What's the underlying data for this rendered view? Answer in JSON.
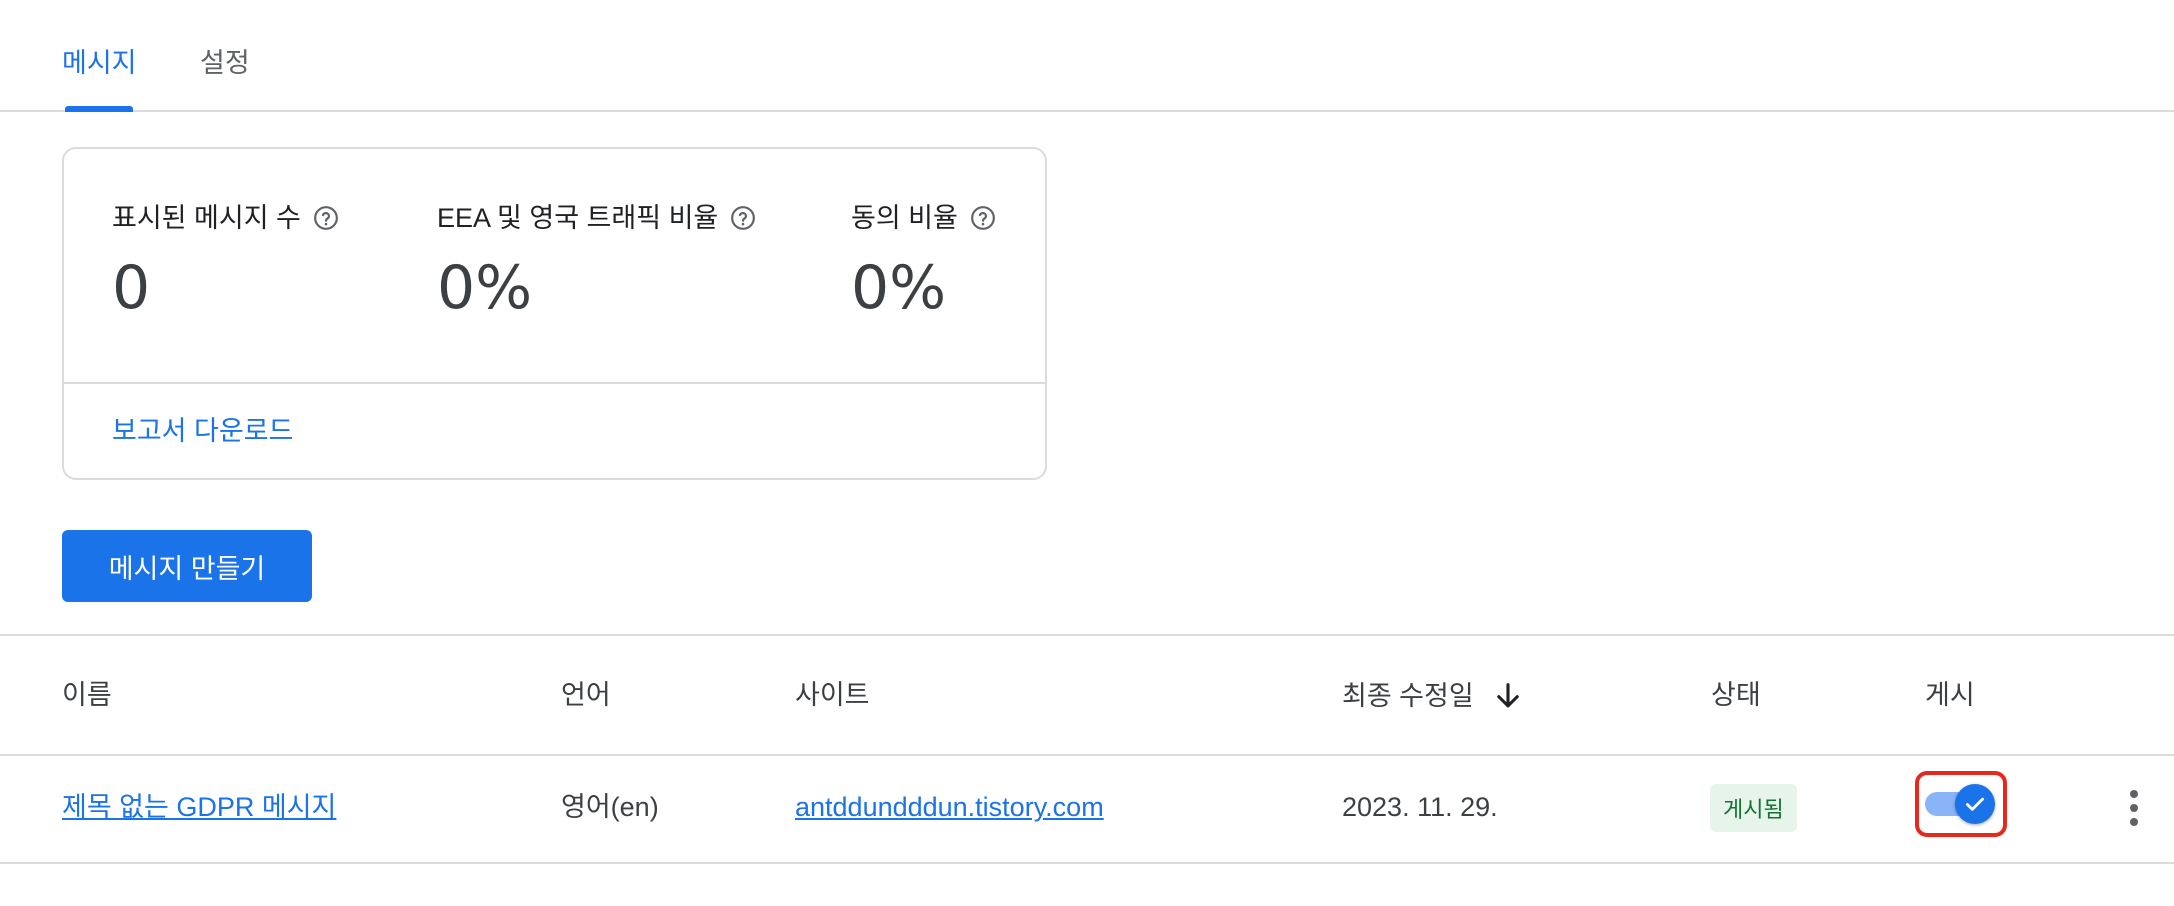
{
  "tabs": [
    {
      "label": "메시지",
      "active": true
    },
    {
      "label": "설정",
      "active": false
    }
  ],
  "stats": {
    "messages_shown": {
      "label": "표시된 메시지 수",
      "value": "0"
    },
    "eea_uk_traffic": {
      "label": "EEA 및 영국 트래픽 비율",
      "value": "0%"
    },
    "consent_rate": {
      "label": "동의 비율",
      "value": "0%"
    },
    "download_label": "보고서 다운로드"
  },
  "create_button_label": "메시지 만들기",
  "table": {
    "headers": {
      "name": "이름",
      "language": "언어",
      "site": "사이트",
      "last_modified": "최종 수정일",
      "status": "상태",
      "publish": "게시"
    },
    "rows": [
      {
        "name": "제목 없는 GDPR 메시지",
        "language": "영어(en)",
        "site": "antddundddun.tistory.com",
        "last_modified": "2023. 11. 29.",
        "status": "게시됨",
        "published": true
      }
    ]
  },
  "colors": {
    "accent": "#1a73e8",
    "status_badge_bg": "#e6f4ea",
    "status_badge_text": "#137333",
    "highlight": "#e8271f"
  },
  "icons": {
    "help": "help-circle-icon",
    "sort": "arrow-down-icon",
    "toggle_check": "check-icon",
    "more": "more-vertical-icon"
  }
}
